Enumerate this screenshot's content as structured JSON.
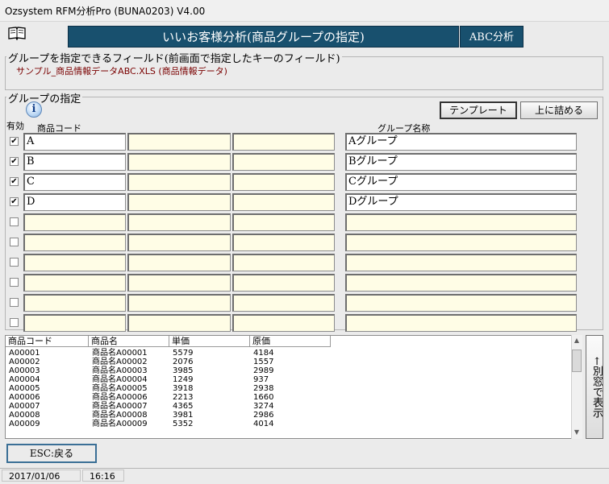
{
  "window": {
    "title": "Ozsystem RFM分析Pro (BUNA0203)   V4.00"
  },
  "header": {
    "title": "いいお客様分析(商品グループの指定)",
    "abc_button": "ABC分析"
  },
  "field_section": {
    "legend": "グループを指定できるフィールド(前画面で指定したキーのフィールド)",
    "value": "サンプル_商品情報データABC.XLS (商品情報データ)"
  },
  "group_section": {
    "legend": "グループの指定",
    "template_button": "テンプレート",
    "shift_up_button": "上に詰める",
    "col_enabled": "有効",
    "col_code": "商品コード",
    "col_group_name": "グループ名称",
    "rows": [
      {
        "checked": true,
        "code": "A",
        "code2": "",
        "code3": "",
        "name": "Aグループ"
      },
      {
        "checked": true,
        "code": "B",
        "code2": "",
        "code3": "",
        "name": "Bグループ"
      },
      {
        "checked": true,
        "code": "C",
        "code2": "",
        "code3": "",
        "name": "Cグループ"
      },
      {
        "checked": true,
        "code": "D",
        "code2": "",
        "code3": "",
        "name": "Dグループ"
      },
      {
        "checked": false,
        "code": "",
        "code2": "",
        "code3": "",
        "name": ""
      },
      {
        "checked": false,
        "code": "",
        "code2": "",
        "code3": "",
        "name": ""
      },
      {
        "checked": false,
        "code": "",
        "code2": "",
        "code3": "",
        "name": ""
      },
      {
        "checked": false,
        "code": "",
        "code2": "",
        "code3": "",
        "name": ""
      },
      {
        "checked": false,
        "code": "",
        "code2": "",
        "code3": "",
        "name": ""
      },
      {
        "checked": false,
        "code": "",
        "code2": "",
        "code3": "",
        "name": ""
      }
    ]
  },
  "list": {
    "columns": [
      "商品コード",
      "商品名",
      "単価",
      "原価"
    ],
    "rows": [
      [
        "A00001",
        "商品名A00001",
        "5579",
        "4184"
      ],
      [
        "A00002",
        "商品名A00002",
        "2076",
        "1557"
      ],
      [
        "A00003",
        "商品名A00003",
        "3985",
        "2989"
      ],
      [
        "A00004",
        "商品名A00004",
        "1249",
        "937"
      ],
      [
        "A00005",
        "商品名A00005",
        "3918",
        "2938"
      ],
      [
        "A00006",
        "商品名A00006",
        "2213",
        "1660"
      ],
      [
        "A00007",
        "商品名A00007",
        "4365",
        "3274"
      ],
      [
        "A00008",
        "商品名A00008",
        "3981",
        "2986"
      ],
      [
        "A00009",
        "商品名A00009",
        "5352",
        "4014"
      ]
    ]
  },
  "popout_button": "←別窓で表示",
  "esc_button": "ESC:戻る",
  "status": {
    "date": "2017/01/06",
    "time": "16:16"
  },
  "icons": {
    "book": "book-icon",
    "info": "info-icon",
    "check": "✔"
  }
}
